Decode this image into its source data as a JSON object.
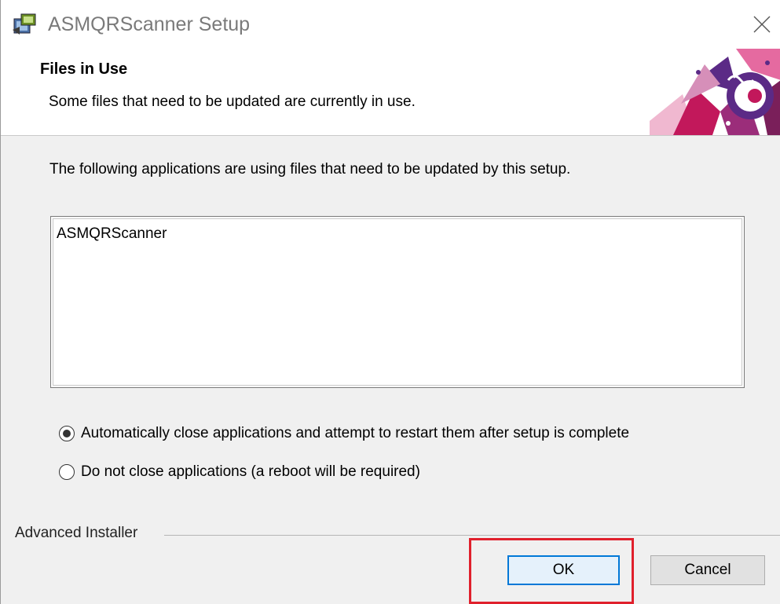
{
  "window": {
    "title": "ASMQRScanner Setup",
    "close_icon": "close-icon"
  },
  "banner": {
    "title": "Files in Use",
    "subtitle": "Some files that need to be updated are currently in use.",
    "logo": "advanced-installer-logo"
  },
  "body": {
    "instructions": "The following applications are using files that need to be updated by this setup.",
    "applications": [
      "ASMQRScanner"
    ]
  },
  "options": {
    "auto_close": {
      "label": "Automatically close applications and attempt to restart them after setup is complete",
      "selected": true
    },
    "do_not_close": {
      "label": "Do not close applications (a reboot will be required)",
      "selected": false
    }
  },
  "footer": {
    "brand": "Advanced Installer",
    "ok_label": "OK",
    "cancel_label": "Cancel"
  },
  "colors": {
    "highlight": "#e0202c",
    "focus_border": "#0078d7",
    "logo_pink": "#c2185b",
    "logo_purple": "#5b2a86"
  }
}
